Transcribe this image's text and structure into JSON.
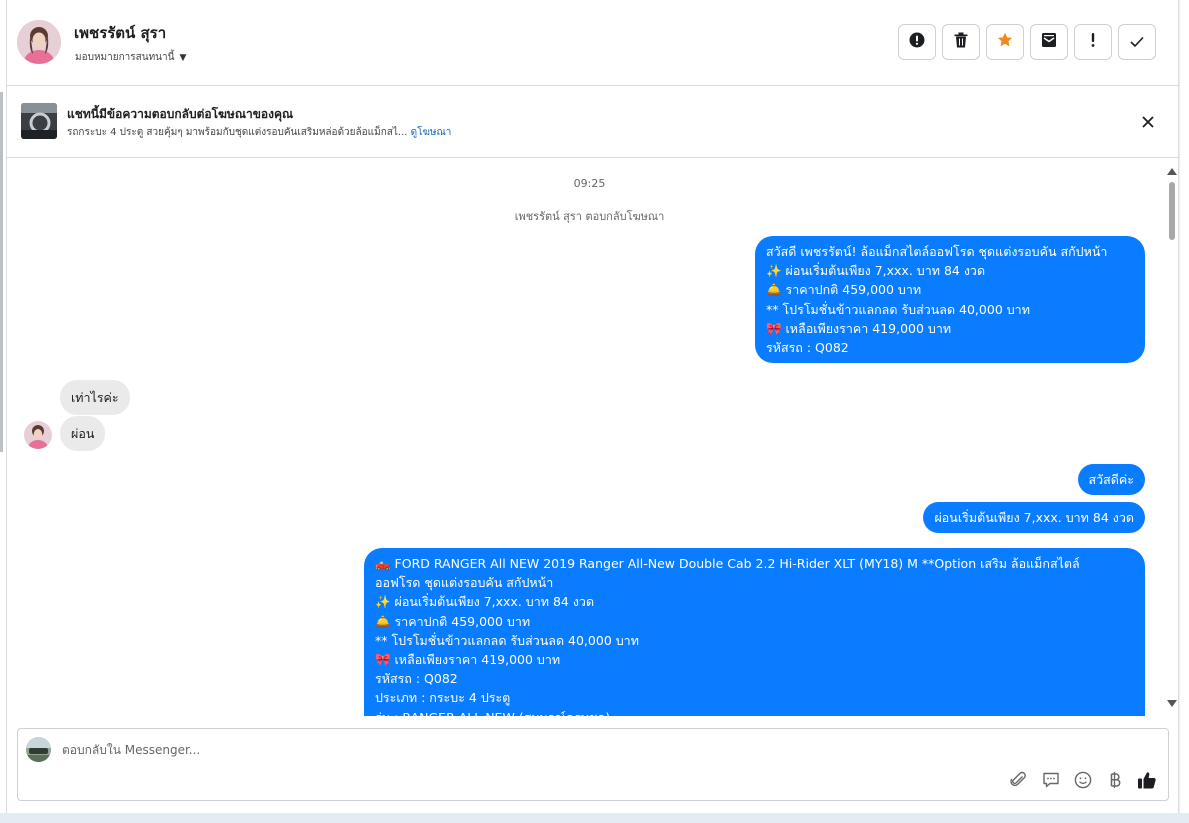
{
  "header": {
    "contact_name": "เพชรรัตน์ สุรา",
    "assign_label": "มอบหมายการสนทนานี้"
  },
  "ad_banner": {
    "title": "แชทนี้มีข้อความตอบกลับต่อโฆษณาของคุณ",
    "description": "รถกระบะ 4 ประตู สวยคุ้มๆ มาพร้อมกับชุดแต่งรอบคันเสริมหล่อด้วยล้อแม็กสไ...",
    "link": "ดูโฆษณา"
  },
  "chat": {
    "timestamp": "09:25",
    "system_note": "เพชรรัตน์ สุรา ตอบกลับโฆษณา",
    "messages": [
      {
        "direction": "outgoing",
        "lines": [
          "สวัสดี เพชรรัตน์! ล้อแม็กสไตล์ออฟโรด ชุดแต่งรอบคัน สกัปหน้า",
          "✨  ผ่อนเริ่มต้นเพียง 7,xxx. บาท 84 งวด",
          "🛎️ ราคาปกติ 459,000 บาท",
          "** โปรโมชั่นข้าวแลกลด รับส่วนลด 40,000 บาท",
          "🎀  เหลือเพียงราคา 419,000 บาท",
          " รหัสรถ : Q082"
        ]
      },
      {
        "direction": "incoming",
        "lines": [
          "เท่าไรค่ะ"
        ]
      },
      {
        "direction": "incoming",
        "lines": [
          "ผ่อน"
        ]
      },
      {
        "direction": "outgoing",
        "lines": [
          "สวัสดีค่ะ"
        ]
      },
      {
        "direction": "outgoing",
        "lines": [
          "ผ่อนเริ่มต้นเพียง 7,xxx. บาท 84 งวด"
        ]
      },
      {
        "direction": "outgoing",
        "lines": [
          "🛻  FORD RANGER All NEW 2019 Ranger All-New Double Cab 2.2 Hi-Rider XLT (MY18) M **Option เสริม ล้อแม็กสไตล์",
          "ออฟโรด ชุดแต่งรอบคัน สกัปหน้า",
          "✨  ผ่อนเริ่มต้นเพียง 7,xxx. บาท 84 งวด",
          "🛎️   ราคาปกติ 459,000 บาท",
          "** โปรโมชั่นข้าวแลกลด รับส่วนลด 40,000 บาท",
          "🎀  เหลือเพียงราคา 419,000 บาท",
          "   รหัสรถ : Q082",
          "   ประเภท : กระบะ 4 ประตู",
          "   รุ่น : RANGER ALL NEW (สมบูรณ์ครบชุด)"
        ]
      }
    ]
  },
  "composer": {
    "placeholder": "ตอบกลับใน Messenger..."
  },
  "icons": {
    "header_actions": [
      "alert-circle-icon",
      "trash-icon",
      "star-icon",
      "mark-unread-icon",
      "exclamation-icon",
      "check-icon"
    ],
    "composer_tools": [
      "paperclip-icon",
      "saved-replies-icon",
      "emoji-icon",
      "baht-icon",
      "thumbs-up-icon"
    ]
  },
  "colors": {
    "accent": "#0a7cff",
    "star": "#f28a1b",
    "link": "#1466c4"
  }
}
